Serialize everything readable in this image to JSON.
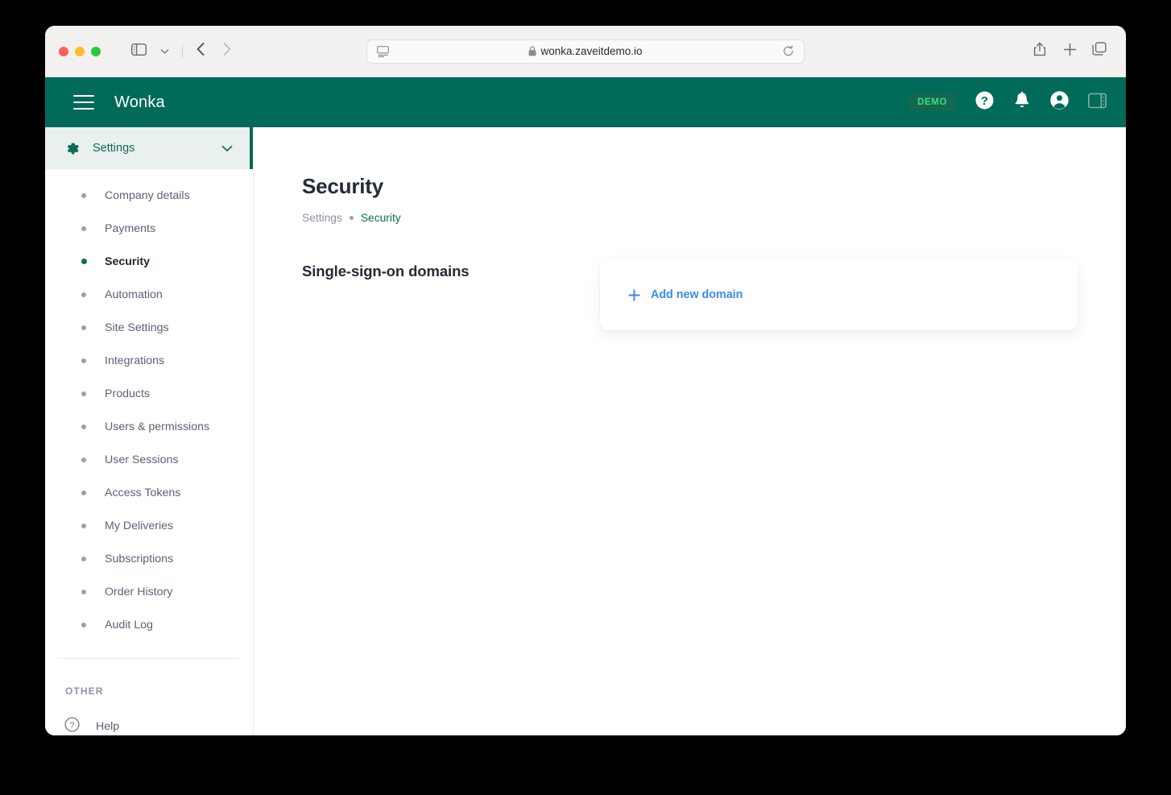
{
  "browser": {
    "url": "wonka.zaveitdemo.io",
    "icons": {
      "sidebar_toggle": "sidebar-toggle-icon",
      "tab_overview_chevron": "chevron-down-icon",
      "back": "back-arrow-icon",
      "forward": "forward-arrow-icon",
      "reader": "reader-view-icon",
      "lock": "lock-icon",
      "reload": "reload-icon",
      "share": "share-icon",
      "new_tab": "plus-icon",
      "tabs": "tabs-overview-icon"
    },
    "traffic_lights": {
      "close": "#ff5f57",
      "minimize": "#febc2e",
      "maximize": "#28c840"
    }
  },
  "app_header": {
    "brand": "Wonka",
    "menu_icon": "hamburger-icon",
    "demo_badge": "DEMO",
    "help_icon": "question-circle-icon",
    "notifications_icon": "bell-icon",
    "account_icon": "account-circle-icon",
    "panel_icon": "right-panel-icon",
    "background": "#016A59",
    "badge_text_color": "#3DDC84"
  },
  "sidebar": {
    "header": {
      "label": "Settings",
      "icon": "gear-icon",
      "chevron": "chevron-down-icon"
    },
    "items": [
      {
        "label": "Company details",
        "active": false
      },
      {
        "label": "Payments",
        "active": false
      },
      {
        "label": "Security",
        "active": true
      },
      {
        "label": "Automation",
        "active": false
      },
      {
        "label": "Site Settings",
        "active": false
      },
      {
        "label": "Integrations",
        "active": false
      },
      {
        "label": "Products",
        "active": false
      },
      {
        "label": "Users & permissions",
        "active": false
      },
      {
        "label": "User Sessions",
        "active": false
      },
      {
        "label": "Access Tokens",
        "active": false
      },
      {
        "label": "My Deliveries",
        "active": false
      },
      {
        "label": "Subscriptions",
        "active": false
      },
      {
        "label": "Order History",
        "active": false
      },
      {
        "label": "Audit Log",
        "active": false
      }
    ],
    "other_section_label": "OTHER",
    "help": {
      "label": "Help",
      "icon": "question-circle-icon"
    },
    "accent_color": "#016A59"
  },
  "main": {
    "title": "Security",
    "breadcrumb": {
      "root": "Settings",
      "current": "Security"
    },
    "section": {
      "title": "Single-sign-on domains",
      "card": {
        "add_label": "Add new domain",
        "add_icon": "plus-icon",
        "link_color": "#3B8BEF"
      }
    }
  }
}
